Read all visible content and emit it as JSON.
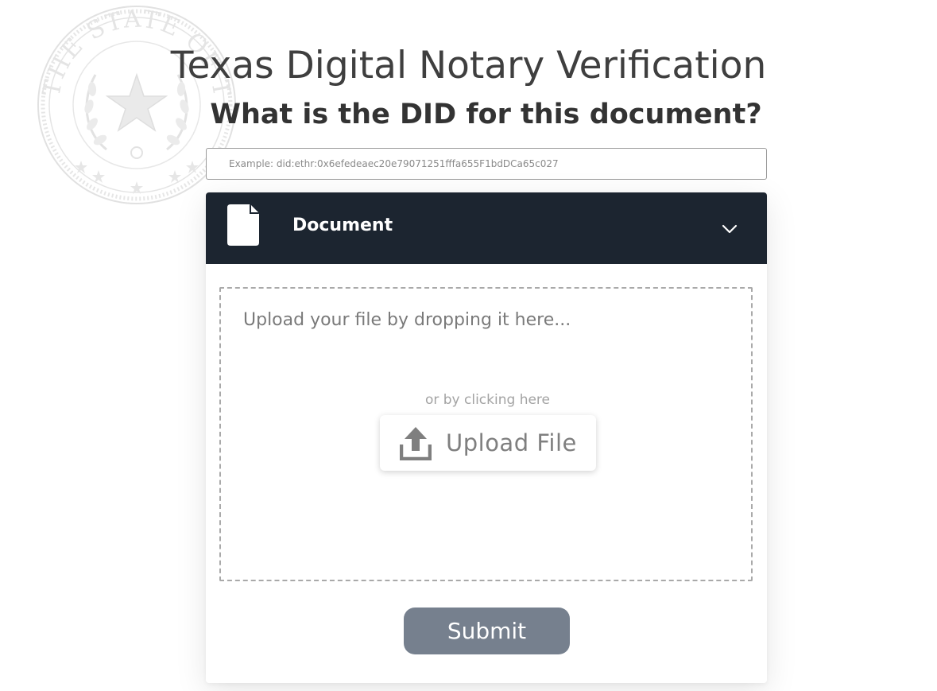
{
  "header": {
    "title": "Texas Digital Notary Verification",
    "question": "What is the DID for this document?"
  },
  "did_input": {
    "placeholder": "Example: did:ethr:0x6efedeaec20e79071251fffa655F1bdDCa65c027",
    "value": ""
  },
  "document_panel": {
    "label": "Document",
    "icons": {
      "file": "file-icon",
      "toggle": "chevron-down-icon"
    },
    "dropzone": {
      "drop_text": "Upload your file by dropping it here...",
      "or_text": "or by clicking here",
      "upload_label": "Upload File",
      "upload_icon": "upload-icon"
    }
  },
  "submit": {
    "label": "Submit"
  },
  "seal": {
    "icon": "texas-state-seal-icon",
    "text": "THE STATE OF TEXAS"
  },
  "colors": {
    "header_bg": "#1c2530",
    "submit_bg": "#76808e",
    "title_text": "#3f3f3f",
    "placeholder_text": "#8a8a8a"
  }
}
